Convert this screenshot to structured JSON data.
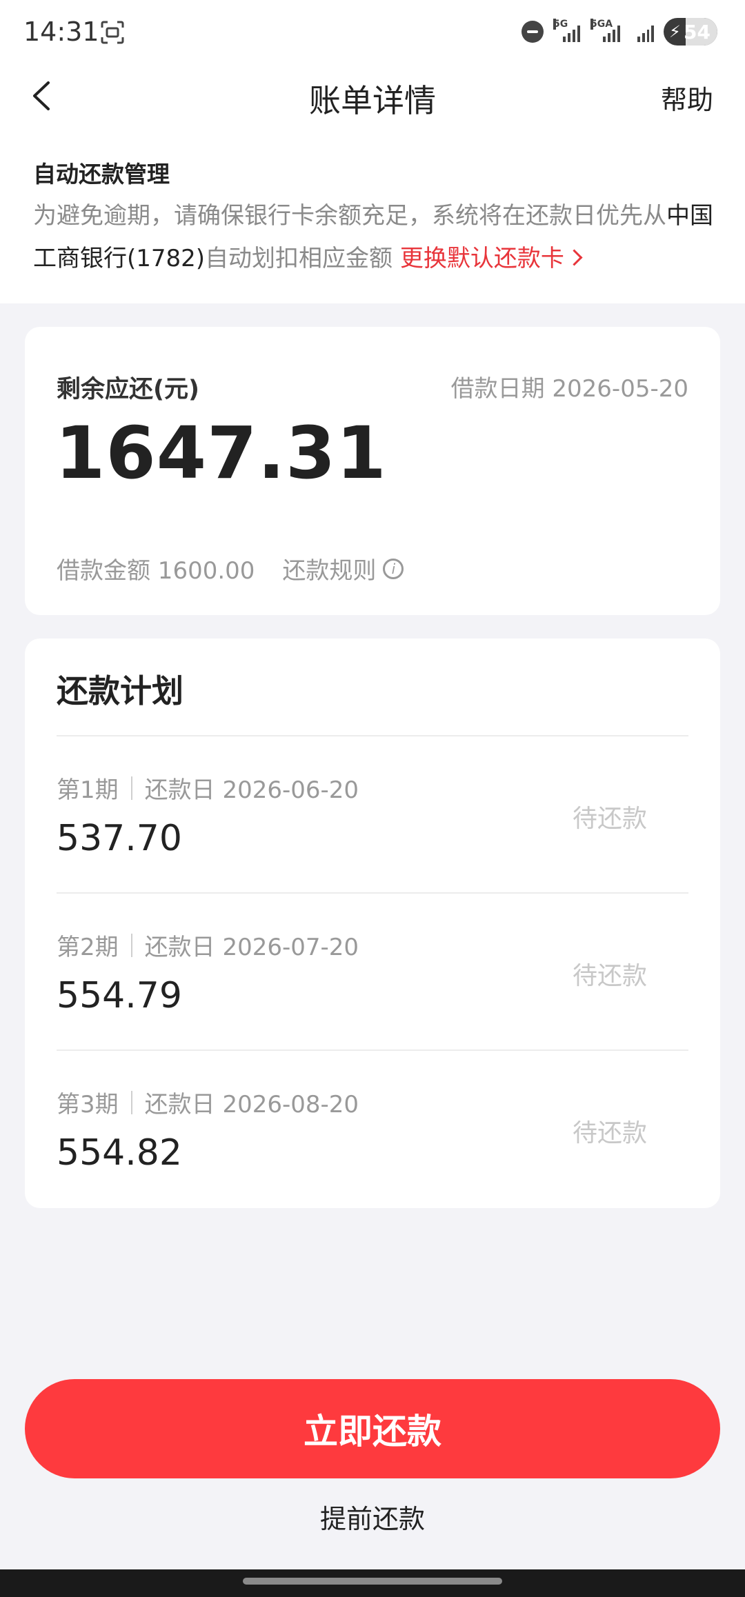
{
  "status_bar": {
    "time": "14:31",
    "signal1_label": "5G",
    "signal2_label": "5GA",
    "battery": "54"
  },
  "nav": {
    "title": "账单详情",
    "help": "帮助"
  },
  "auto_repay": {
    "title": "自动还款管理",
    "desc_prefix": "为避免逾期，请确保银行卡余额充足，系统将在还款日优先从",
    "bank": "中国工商银行(1782)",
    "desc_suffix": "自动划扣相应金额",
    "change_card_link": "更换默认还款卡"
  },
  "summary": {
    "remaining_label": "剩余应还(元)",
    "loan_date": "借款日期 2026-05-20",
    "remaining_amount": "1647.31",
    "loan_amount": "借款金额 1600.00",
    "rules_label": "还款规则"
  },
  "plan": {
    "title": "还款计划",
    "rows": [
      {
        "period": "第1期",
        "due": "还款日 2026-06-20",
        "amount": "537.70",
        "status": "待还款"
      },
      {
        "period": "第2期",
        "due": "还款日 2026-07-20",
        "amount": "554.79",
        "status": "待还款"
      },
      {
        "period": "第3期",
        "due": "还款日 2026-08-20",
        "amount": "554.82",
        "status": "待还款"
      }
    ]
  },
  "actions": {
    "pay_now": "立即还款",
    "prepay": "提前还款"
  },
  "colors": {
    "accent": "#fe3a3e",
    "link_red": "#e8353b"
  }
}
